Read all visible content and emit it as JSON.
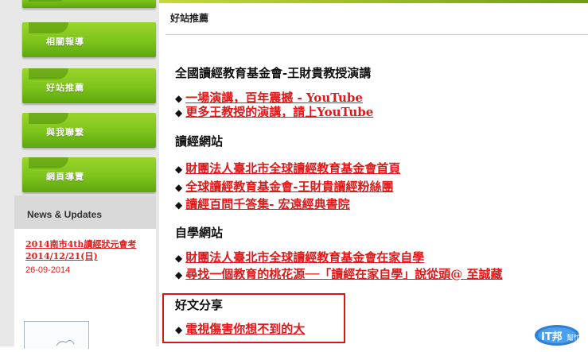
{
  "sidebar": {
    "items": [
      {
        "label": "相關報導"
      },
      {
        "label": "好站推薦"
      },
      {
        "label": "與我聯繫"
      },
      {
        "label": "網頁導覽"
      }
    ],
    "news": {
      "heading": "News & Updates",
      "link_text": "2014南市4th讀經狀元會考 2014/12/21(日)",
      "date": "26-09-2014"
    }
  },
  "main": {
    "page_title": "好站推薦",
    "sections": [
      {
        "heading": "全國讀經教育基金會-王財貴教授演講",
        "links": [
          "一場演講，百年震撼 - YouTube",
          "更多王教授的演講，請上YouTube"
        ]
      },
      {
        "heading": "讀經網站",
        "links": [
          "財團法人臺北市全球讀經教育基金會首頁",
          "全球讀經教育基金會-王財貴讀經粉絲團",
          "讀經百問千答集- 宏遠經典書院"
        ]
      },
      {
        "heading": "自學網站",
        "links": [
          "財團法人臺北市全球讀經教育基金會在家自學",
          "尋找一個教育的桃花源──「讀經在家自學」說從頭@ 至誠藏"
        ]
      },
      {
        "heading": "好文分享",
        "links": [
          "電視傷害你想不到的大"
        ]
      }
    ],
    "bullet_symbol": "◆"
  },
  "badge": {
    "text": "IT邦",
    "subtext": "幫忙"
  },
  "colors": {
    "accent_green": "#7cc41b",
    "link_red": "#e01818",
    "highlight_border": "#d81818"
  }
}
